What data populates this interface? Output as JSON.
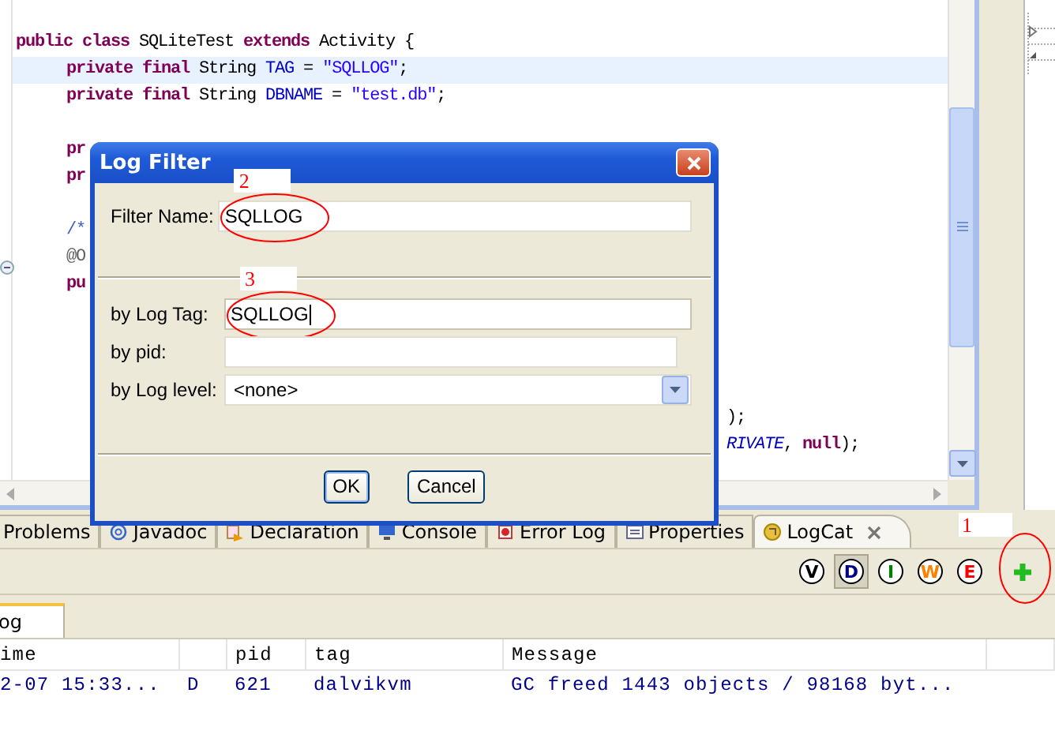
{
  "editor": {
    "lines": [
      {
        "highlighted": false,
        "indented": false,
        "tokens": [
          {
            "text": "public class",
            "kind": "keyword"
          },
          {
            "text": " SQLiteTest ",
            "kind": "plain"
          },
          {
            "text": "extends",
            "kind": "keyword"
          },
          {
            "text": " Activity {",
            "kind": "plain"
          }
        ]
      },
      {
        "highlighted": true,
        "indented": true,
        "tokens": [
          {
            "text": "private final",
            "kind": "keyword"
          },
          {
            "text": " String ",
            "kind": "plain"
          },
          {
            "text": "TAG",
            "kind": "field"
          },
          {
            "text": " = ",
            "kind": "plain"
          },
          {
            "text": "\"SQLLOG\"",
            "kind": "string"
          },
          {
            "text": ";",
            "kind": "plain"
          }
        ]
      },
      {
        "highlighted": false,
        "indented": true,
        "tokens": [
          {
            "text": "private final",
            "kind": "keyword"
          },
          {
            "text": " String ",
            "kind": "plain"
          },
          {
            "text": "DBNAME",
            "kind": "field"
          },
          {
            "text": " = ",
            "kind": "plain"
          },
          {
            "text": "\"test.db\"",
            "kind": "string"
          },
          {
            "text": ";",
            "kind": "plain"
          }
        ]
      },
      {
        "highlighted": false
      },
      {
        "highlighted": false,
        "indented": true,
        "tokens": [
          {
            "text": "pr",
            "kind": "keyword"
          }
        ]
      },
      {
        "highlighted": false,
        "indented": true,
        "tokens": [
          {
            "text": "pr",
            "kind": "keyword"
          }
        ]
      },
      {
        "highlighted": false
      },
      {
        "highlighted": false,
        "indented": true,
        "tokens": [
          {
            "text": "/*",
            "kind": "comment"
          }
        ]
      },
      {
        "highlighted": false,
        "indented": true,
        "folded": true,
        "tokens": [
          {
            "text": "@O",
            "kind": "annotation"
          }
        ]
      },
      {
        "highlighted": false,
        "indented": true,
        "tokens": [
          {
            "text": "pu",
            "kind": "keyword"
          }
        ]
      },
      {
        "highlighted": false
      },
      {
        "highlighted": false
      },
      {
        "highlighted": false
      },
      {
        "highlighted": false
      },
      {
        "highlighted": false,
        "tail": [
          {
            "text": ");",
            "kind": "plain"
          }
        ]
      },
      {
        "highlighted": false,
        "tail": [
          {
            "text": "RIVATE",
            "kind": "constant"
          },
          {
            "text": ", ",
            "kind": "plain"
          },
          {
            "text": "null",
            "kind": "keyword"
          },
          {
            "text": ");",
            "kind": "plain"
          }
        ]
      }
    ]
  },
  "dialog": {
    "title": "Log Filter",
    "sections": [
      {
        "fields": [
          {
            "label": "Filter Name:",
            "kind": "text",
            "value": "SQLLOG",
            "focused": false,
            "annotation": "2"
          }
        ]
      },
      {
        "fields": [
          {
            "label": "by Log Tag:",
            "kind": "text",
            "value": "SQLLOG",
            "focused": true,
            "annotation": "3"
          },
          {
            "label": "by pid:",
            "kind": "number",
            "focused": false
          },
          {
            "label": "by Log level:",
            "kind": "combo",
            "value": "<none>",
            "focused": false
          }
        ]
      }
    ],
    "buttons": [
      {
        "label": "OK",
        "default": true
      },
      {
        "label": "Cancel",
        "default": false
      }
    ]
  },
  "panel": {
    "tabs": [
      {
        "label": "Problems",
        "selected": false
      },
      {
        "label": "Javadoc",
        "selected": false
      },
      {
        "label": "Declaration",
        "selected": false
      },
      {
        "label": "Console",
        "selected": false
      },
      {
        "label": "Error Log",
        "selected": false
      },
      {
        "label": "Properties",
        "selected": false
      },
      {
        "label": "LogCat",
        "selected": true
      }
    ],
    "annotation": "1",
    "levels": [
      {
        "label": "V",
        "selected": false,
        "color": "#000000"
      },
      {
        "label": "D",
        "selected": true,
        "color": "#00008b"
      },
      {
        "label": "I",
        "selected": false,
        "color": "#008000"
      },
      {
        "label": "W",
        "selected": false,
        "color": "#ff8000"
      },
      {
        "label": "E",
        "selected": false,
        "color": "#ff0000"
      }
    ],
    "log_tabs": [
      {
        "label": "og",
        "selected": true
      }
    ],
    "table": {
      "columns": [
        "ime",
        "pid",
        "tag",
        "Message"
      ],
      "rows": [
        {
          "time": "2-07 15:33...",
          "level": "D",
          "pid": "621",
          "tag": "dalvikvm",
          "message": "GC freed 1443 objects / 98168 byt..."
        }
      ]
    }
  }
}
